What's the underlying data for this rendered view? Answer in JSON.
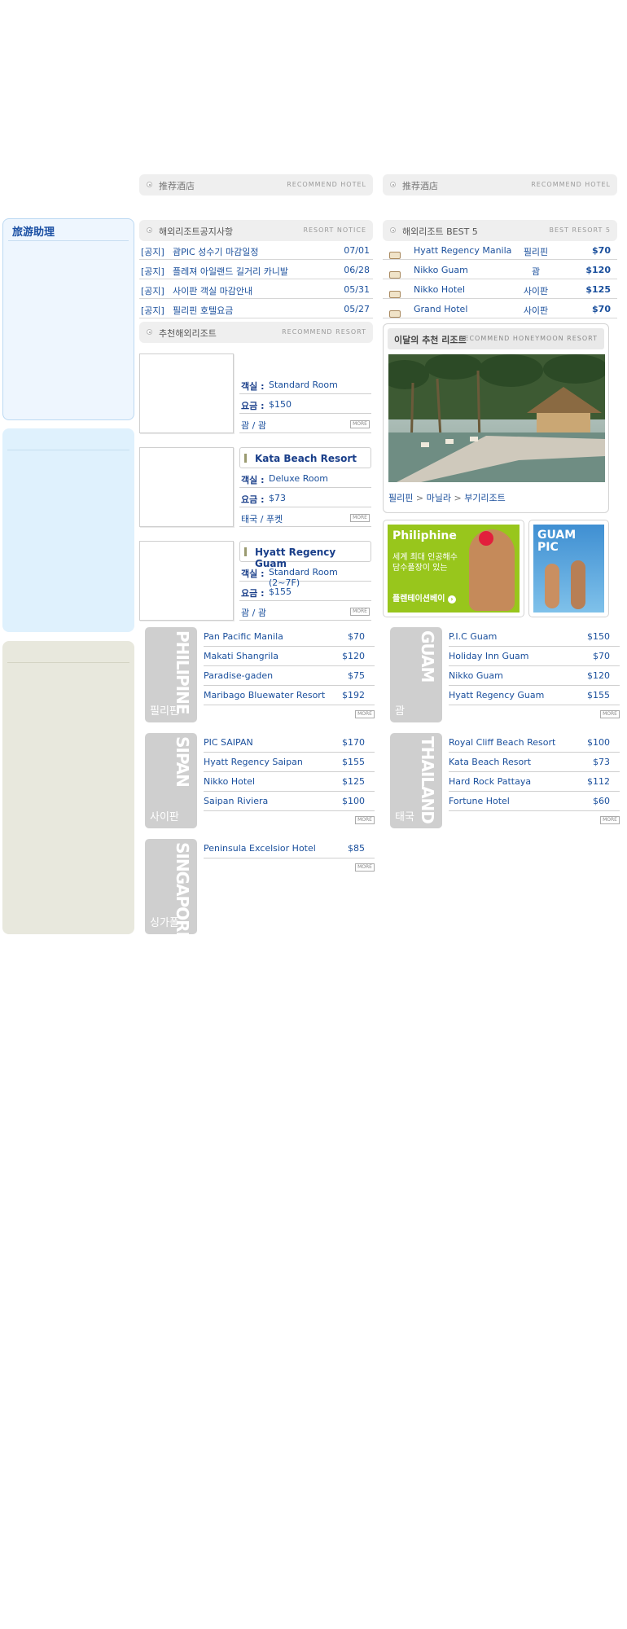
{
  "header": {
    "left_bar": {
      "title": "推荐酒店",
      "en": "RECOMMEND HOTEL"
    },
    "right_bar": {
      "title": "推荐酒店",
      "en": "RECOMMEND HOTEL"
    }
  },
  "sidebar": {
    "title": "旅游助理"
  },
  "notice": {
    "title": "해외리조트공지사항",
    "en": "RESORT NOTICE",
    "items": [
      {
        "tag": "[공지]",
        "text": "괌PIC 성수기 마감일정",
        "date": "07/01"
      },
      {
        "tag": "[공지]",
        "text": "플레져 아일랜드 길거리 카니발",
        "date": "06/28"
      },
      {
        "tag": "[공지]",
        "text": "사이판 객실 마감안내",
        "date": "05/31"
      },
      {
        "tag": "[공지]",
        "text": "필리핀 호텔요금",
        "date": "05/27"
      }
    ]
  },
  "best": {
    "title": "해외리조트 BEST 5",
    "en": "BEST RESORT 5",
    "items": [
      {
        "name": "Hyatt Regency Manila",
        "region": "필리핀",
        "price": "$70"
      },
      {
        "name": "Nikko Guam",
        "region": "괌",
        "price": "$120"
      },
      {
        "name": "Nikko Hotel",
        "region": "사이판",
        "price": "$125"
      },
      {
        "name": "Grand Hotel",
        "region": "사이판",
        "price": "$70"
      }
    ]
  },
  "recommend": {
    "title": "추천해외리조트",
    "en": "RECOMMEND RESORT",
    "more": "MORE",
    "items": [
      {
        "name": "",
        "room_label": "객실 :",
        "room": "Standard Room",
        "price_label": "요금 :",
        "price": "$150",
        "location": "괌 / 괌"
      },
      {
        "name": "Kata Beach Resort",
        "room_label": "객실 :",
        "room": "Deluxe Room",
        "price_label": "요금 :",
        "price": "$73",
        "location": "태국 / 푸켓"
      },
      {
        "name": "Hyatt Regency Guam",
        "room_label": "객실 :",
        "room": "Standard Room (2~7F)",
        "price_label": "요금 :",
        "price": "$155",
        "location": "괌 / 괌"
      }
    ]
  },
  "honeymoon": {
    "title": "이달의 추천 리조트",
    "en": "RECOMMEND HONEYMOON RESORT",
    "path": [
      "필리핀",
      "마닐라",
      "부기리조트"
    ]
  },
  "promo": {
    "title": "Philiphine",
    "line1": "세계 최대 인공해수",
    "line2": "담수풀장이 있는",
    "cta": "플렌테이션베이",
    "guam": "GUAM PIC"
  },
  "regions": [
    {
      "en": "PHILIPINE",
      "ko": "필리핀",
      "hotels": [
        {
          "name": "Pan Pacific Manila",
          "price": "$70"
        },
        {
          "name": "Makati Shangrila",
          "price": "$120"
        },
        {
          "name": "Paradise-gaden",
          "price": "$75"
        },
        {
          "name": "Maribago Bluewater Resort",
          "price": "$192"
        }
      ]
    },
    {
      "en": "GUAM",
      "ko": "괌",
      "hotels": [
        {
          "name": "P.I.C Guam",
          "price": "$150"
        },
        {
          "name": "Holiday Inn Guam",
          "price": "$70"
        },
        {
          "name": "Nikko Guam",
          "price": "$120"
        },
        {
          "name": "Hyatt Regency Guam",
          "price": "$155"
        }
      ]
    },
    {
      "en": "SIPAN",
      "ko": "사이판",
      "hotels": [
        {
          "name": "PIC SAIPAN",
          "price": "$170"
        },
        {
          "name": "Hyatt Regency Saipan",
          "price": "$155"
        },
        {
          "name": "Nikko Hotel",
          "price": "$125"
        },
        {
          "name": "Saipan Riviera",
          "price": "$100"
        }
      ]
    },
    {
      "en": "THAILAND",
      "ko": "태국",
      "hotels": [
        {
          "name": "Royal Cliff Beach Resort",
          "price": "$100"
        },
        {
          "name": "Kata Beach Resort",
          "price": "$73"
        },
        {
          "name": "Hard Rock Pattaya",
          "price": "$112"
        },
        {
          "name": "Fortune Hotel",
          "price": "$60"
        }
      ]
    },
    {
      "en": "SINGAPORE",
      "ko": "싱가폴",
      "hotels": [
        {
          "name": "Peninsula Excelsior Hotel",
          "price": "$85"
        }
      ]
    }
  ]
}
